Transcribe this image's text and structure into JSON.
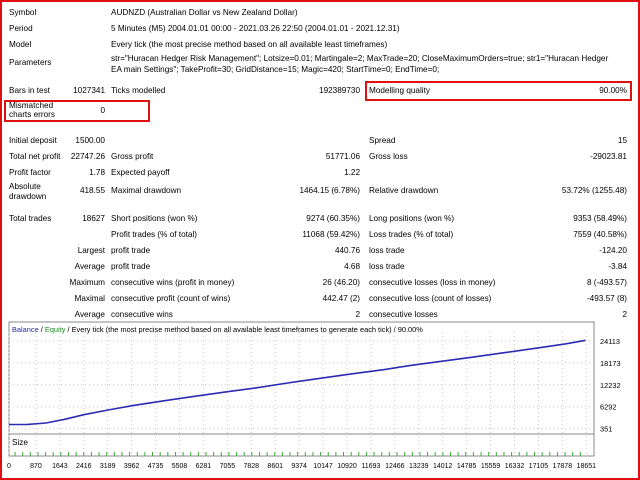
{
  "report": {
    "symbol_label": "Symbol",
    "symbol_value": "AUDNZD (Australian Dollar vs New Zealand Dollar)",
    "period_label": "Period",
    "period_value": "5 Minutes (M5) 2004.01.01 00:00 - 2021.03.26 22:50 (2004.01.01 - 2021.12.31)",
    "model_label": "Model",
    "model_value": "Every tick (the most precise method based on all available least timeframes)",
    "parameters_label": "Parameters",
    "parameters_line1": "str=\"Huracan Hedger Risk Management\"; Lotsize=0.01; Martingale=2; MaxTrade=20; CloseMaximumOrders=true; str1=\"Huracan Hedger",
    "parameters_line2": "EA main Settings\"; TakeProfit=30; GridDistance=15; Magic=420; StartTime=0; EndTime=0;",
    "bars_label": "Bars in test",
    "bars_value": "1027341",
    "ticks_label": "Ticks modelled",
    "ticks_value": "192389730",
    "quality_label": "Modelling quality",
    "quality_value": "90.00%",
    "mismatch_label_1": "Mismatched",
    "mismatch_label_2": "charts errors",
    "mismatch_value": "0",
    "initial_deposit_label": "Initial deposit",
    "initial_deposit_value": "1500.00",
    "spread_label": "Spread",
    "spread_value": "15",
    "net_profit_label": "Total net profit",
    "net_profit_value": "22747.26",
    "gross_profit_label": "Gross profit",
    "gross_profit_value": "51771.06",
    "gross_loss_label": "Gross loss",
    "gross_loss_value": "-29023.81",
    "profit_factor_label": "Profit factor",
    "profit_factor_value": "1.78",
    "expected_payoff_label": "Expected payoff",
    "expected_payoff_value": "1.22",
    "abs_dd_label_1": "Absolute",
    "abs_dd_label_2": "drawdown",
    "abs_dd_value": "418.55",
    "max_dd_label": "Maximal drawdown",
    "max_dd_value": "1464.15 (6.78%)",
    "rel_dd_label": "Relative drawdown",
    "rel_dd_value": "53.72% (1255.48)",
    "total_trades_label": "Total trades",
    "total_trades_value": "18627",
    "short_label": "Short positions (won %)",
    "short_value": "9274 (60.35%)",
    "long_label": "Long positions (won %)",
    "long_value": "9353 (58.49%)",
    "profit_trades_label": "Profit trades (% of total)",
    "profit_trades_value": "11068 (59.42%)",
    "loss_trades_label": "Loss trades (% of total)",
    "loss_trades_value": "7559 (40.58%)",
    "largest_label": "Largest",
    "largest_profit_label": "profit trade",
    "largest_profit_value": "440.76",
    "largest_loss_label": "loss trade",
    "largest_loss_value": "-124.20",
    "average_label": "Average",
    "average_profit_label": "profit trade",
    "average_profit_value": "4.68",
    "average_loss_label": "loss trade",
    "average_loss_value": "-3.84",
    "maximum_label": "Maximum",
    "max_cons_wins_label": "consecutive wins (profit in money)",
    "max_cons_wins_value": "26 (46.20)",
    "max_cons_losses_label": "consecutive losses (loss in money)",
    "max_cons_losses_value": "8 (-493.57)",
    "maximal_label": "Maximal",
    "maximal_cons_profit_label": "consecutive profit (count of wins)",
    "maximal_cons_profit_value": "442.47 (2)",
    "maximal_cons_loss_label": "consecutive loss (count of losses)",
    "maximal_cons_loss_value": "-493.57 (8)",
    "average2_label": "Average",
    "avg_cons_wins_label": "consecutive wins",
    "avg_cons_wins_value": "2",
    "avg_cons_losses_label": "consecutive losses",
    "avg_cons_losses_value": "2"
  },
  "chart_data": {
    "type": "line",
    "title_balance": "Balance",
    "title_sep": " / ",
    "title_equity": "Equity",
    "title_rest": " / Every tick (the most precise method based on all available least timeframes to generate each tick) / 90.00%",
    "size_label": "Size",
    "yticks": [
      351,
      6292,
      12232,
      18173,
      24113
    ],
    "ylim": [
      0,
      26500
    ],
    "xticks": [
      0,
      870,
      1643,
      2416,
      3189,
      3962,
      4735,
      5508,
      6281,
      7055,
      7828,
      8601,
      9374,
      10147,
      10920,
      11693,
      12466,
      13239,
      14012,
      14785,
      15559,
      16332,
      17105,
      17878,
      18651
    ],
    "xlim": [
      0,
      18900
    ],
    "series": [
      {
        "name": "Balance",
        "color": "#2b2bb3",
        "x": [
          0,
          600,
          1200,
          1800,
          2400,
          3200,
          4000,
          5000,
          6000,
          7000,
          8000,
          9000,
          10000,
          11000,
          12000,
          13000,
          14000,
          15000,
          16000,
          17000,
          18000,
          18627
        ],
        "y": [
          1500,
          1520,
          1900,
          2900,
          4100,
          5400,
          6600,
          7900,
          9100,
          10300,
          11400,
          12700,
          13900,
          15100,
          16200,
          17500,
          18600,
          19700,
          20900,
          22100,
          23300,
          24247
        ]
      }
    ],
    "colors": {
      "balance": "#2b2bb3",
      "equity": "#1a8f1a",
      "grid": "#c8c8c8",
      "size_bars": "#3aa83a"
    }
  }
}
